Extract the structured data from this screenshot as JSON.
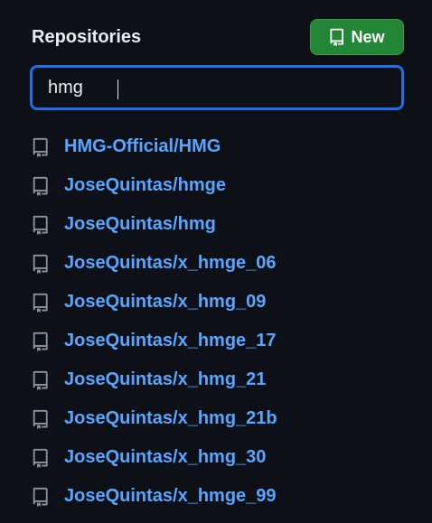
{
  "header": {
    "title": "Repositories",
    "new_button_label": "New"
  },
  "search": {
    "value": "hmg"
  },
  "repos": [
    {
      "name": "HMG-Official/HMG"
    },
    {
      "name": "JoseQuintas/hmge"
    },
    {
      "name": "JoseQuintas/hmg"
    },
    {
      "name": "JoseQuintas/x_hmge_06"
    },
    {
      "name": "JoseQuintas/x_hmg_09"
    },
    {
      "name": "JoseQuintas/x_hmge_17"
    },
    {
      "name": "JoseQuintas/x_hmg_21"
    },
    {
      "name": "JoseQuintas/x_hmg_21b"
    },
    {
      "name": "JoseQuintas/x_hmg_30"
    },
    {
      "name": "JoseQuintas/x_hmge_99"
    }
  ],
  "icons": {
    "repo": "repo-icon",
    "new": "repo-icon"
  },
  "colors": {
    "background": "#0d1117",
    "link": "#58a6ff",
    "accent_button": "#238636",
    "focus_border": "#1f6feb",
    "text": "#e6edf3",
    "icon": "#8b949e"
  }
}
